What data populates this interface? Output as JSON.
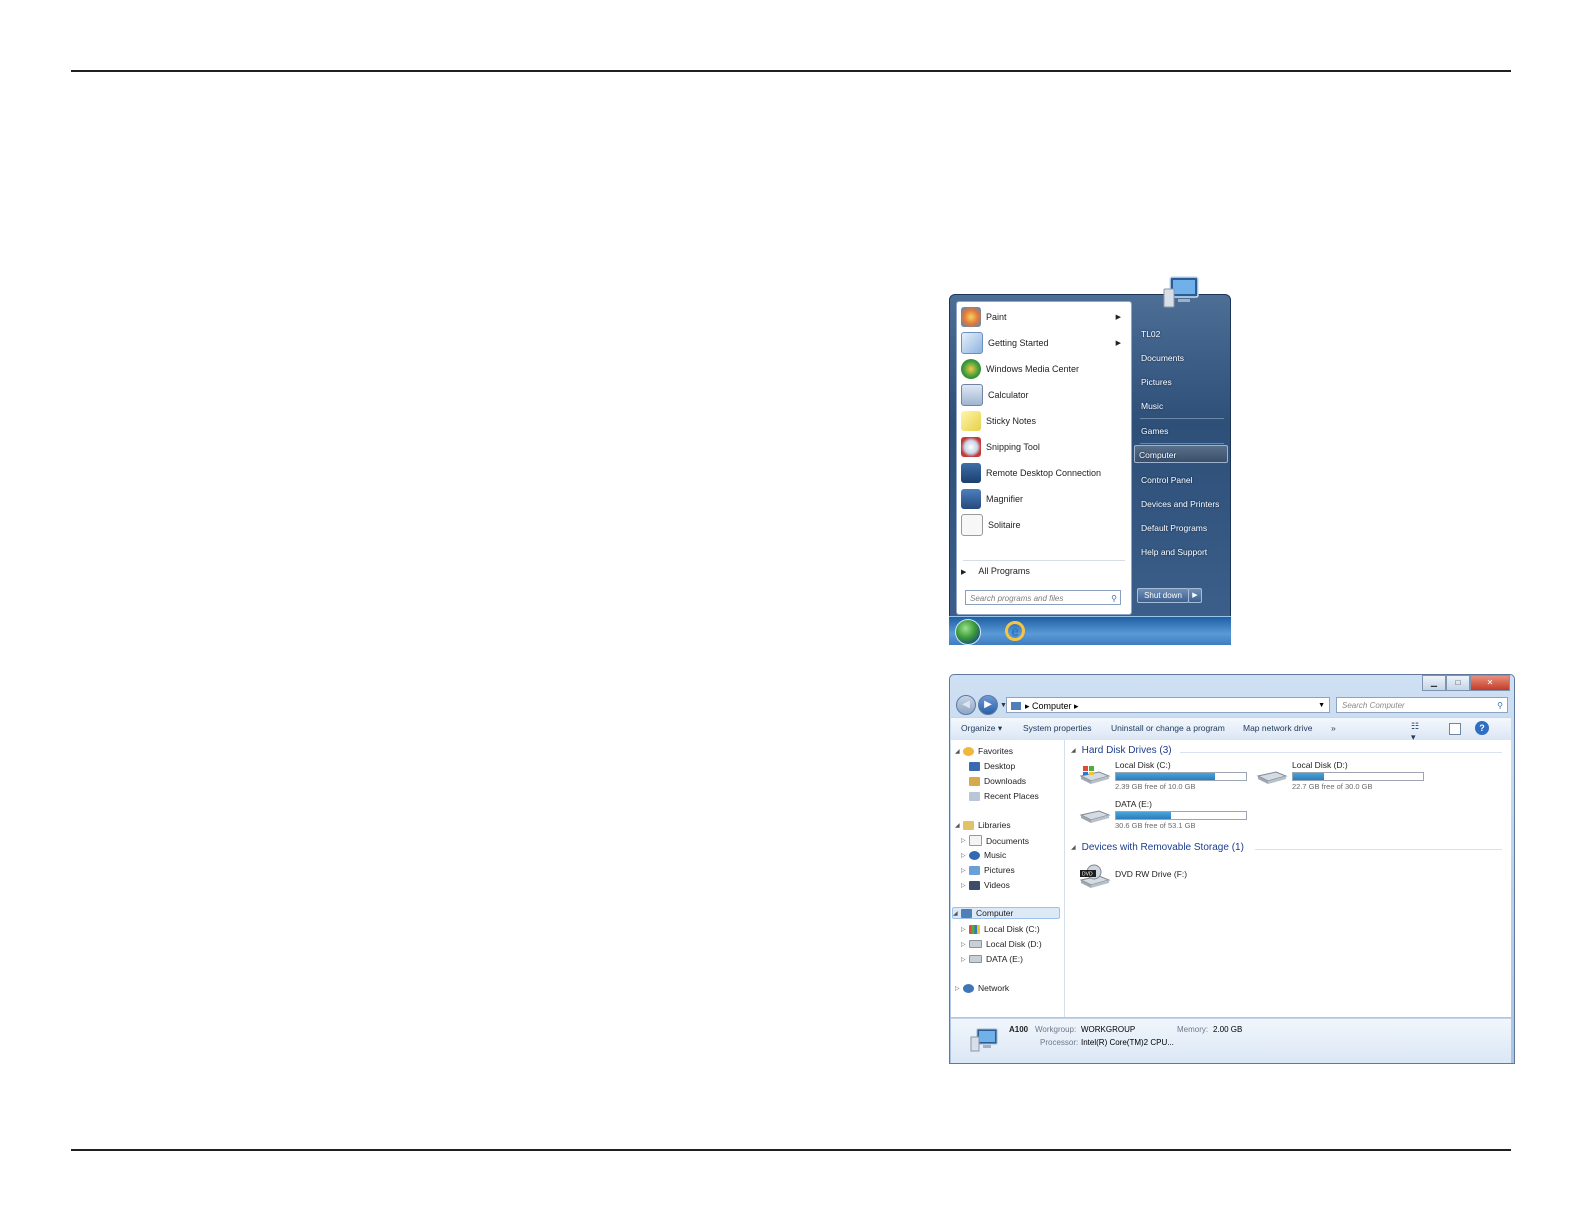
{
  "start_menu": {
    "programs": [
      {
        "label": "Paint",
        "icon": "paint-icon",
        "has_submenu": true
      },
      {
        "label": "Getting Started",
        "icon": "getting-started-icon",
        "has_submenu": true
      },
      {
        "label": "Windows Media Center",
        "icon": "media-center-icon",
        "has_submenu": false
      },
      {
        "label": "Calculator",
        "icon": "calculator-icon",
        "has_submenu": false
      },
      {
        "label": "Sticky Notes",
        "icon": "sticky-notes-icon",
        "has_submenu": false
      },
      {
        "label": "Snipping Tool",
        "icon": "snipping-tool-icon",
        "has_submenu": false
      },
      {
        "label": "Remote Desktop Connection",
        "icon": "remote-desktop-icon",
        "has_submenu": false
      },
      {
        "label": "Magnifier",
        "icon": "magnifier-icon",
        "has_submenu": false
      },
      {
        "label": "Solitaire",
        "icon": "solitaire-icon",
        "has_submenu": false
      }
    ],
    "all_programs": "All Programs",
    "search_placeholder": "Search programs and files",
    "right_items": [
      "TL02",
      "Documents",
      "Pictures",
      "Music",
      "Games",
      "Computer",
      "Control Panel",
      "Devices and Printers",
      "Default Programs",
      "Help and Support"
    ],
    "selected_right_item": "Computer",
    "shutdown": "Shut down"
  },
  "explorer": {
    "address_path": "Computer",
    "search_placeholder": "Search Computer",
    "toolbar": {
      "organize": "Organize",
      "system_properties": "System properties",
      "uninstall": "Uninstall or change a program",
      "map_network": "Map network drive",
      "more": "»"
    },
    "nav_pane": {
      "favorites": "Favorites",
      "desktop": "Desktop",
      "downloads": "Downloads",
      "recent_places": "Recent Places",
      "libraries": "Libraries",
      "documents": "Documents",
      "music": "Music",
      "pictures": "Pictures",
      "videos": "Videos",
      "computer": "Computer",
      "local_c": "Local Disk (C:)",
      "local_d": "Local Disk (D:)",
      "data_e": "DATA (E:)",
      "network": "Network"
    },
    "groups": {
      "hard_disks": "Hard Disk Drives (3)",
      "removable": "Devices with Removable Storage (1)"
    },
    "drives": [
      {
        "name": "Local Disk (C:)",
        "free_text": "2.39 GB free of 10.0 GB",
        "used_fraction": 0.76
      },
      {
        "name": "Local Disk (D:)",
        "free_text": "22.7 GB free of 30.0 GB",
        "used_fraction": 0.24
      },
      {
        "name": "DATA (E:)",
        "free_text": "30.6 GB free of 53.1 GB",
        "used_fraction": 0.42
      }
    ],
    "dvd": {
      "name": "DVD RW Drive (F:)",
      "icon_label": "DVD"
    },
    "details": {
      "computer_name": "A100",
      "workgroup_label": "Workgroup:",
      "workgroup": "WORKGROUP",
      "memory_label": "Memory:",
      "memory": "2.00 GB",
      "processor_label": "Processor:",
      "processor": "Intel(R) Core(TM)2 CPU..."
    }
  }
}
